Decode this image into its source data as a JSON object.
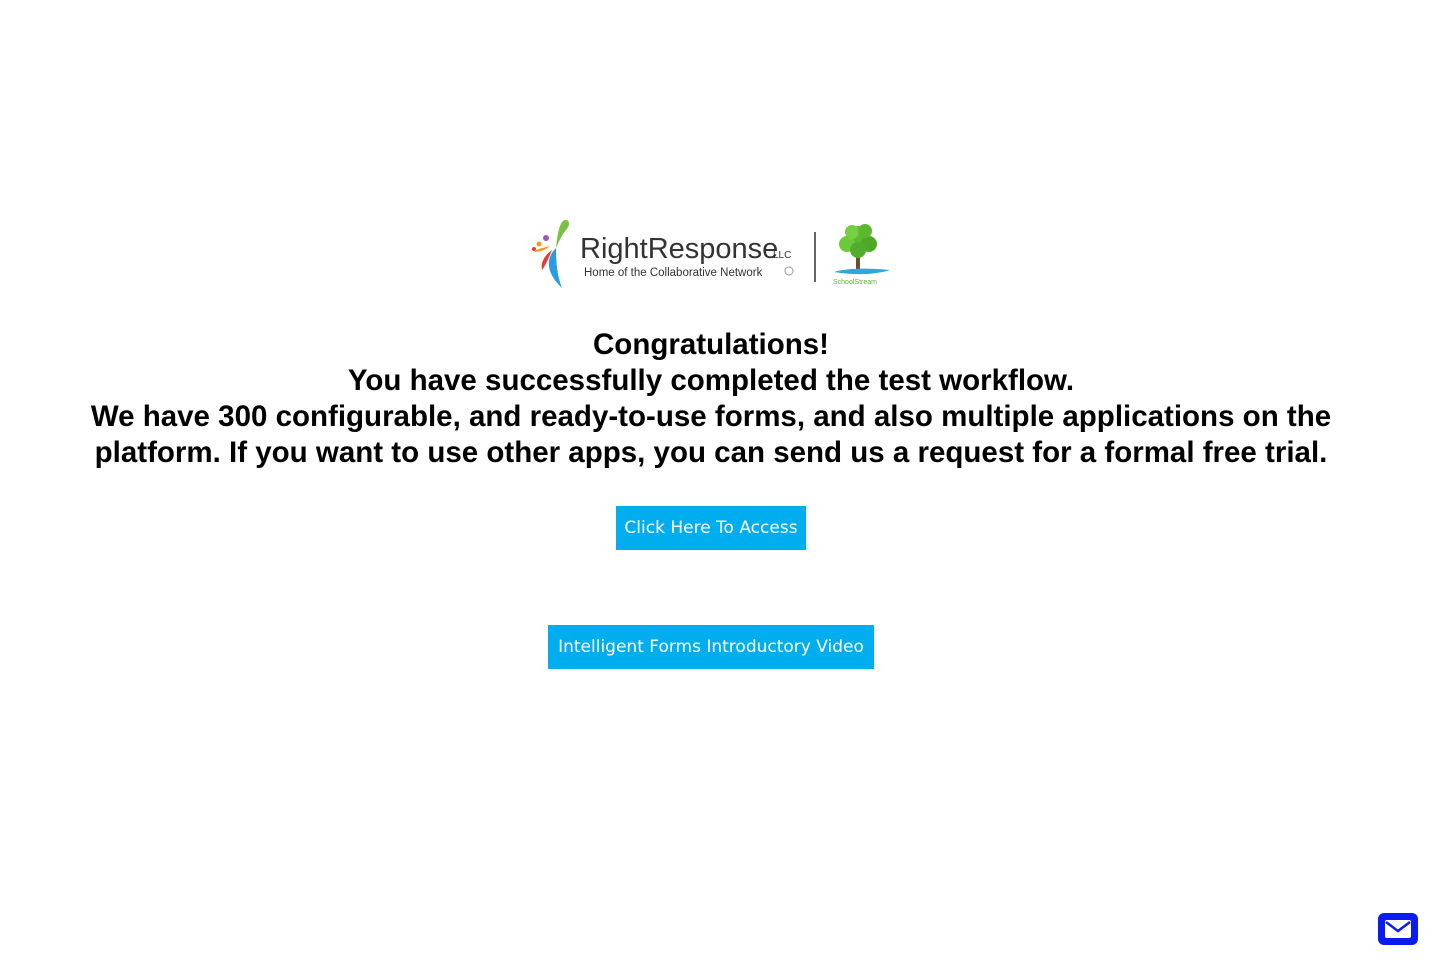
{
  "logo": {
    "brand_name": "RightResponse",
    "brand_suffix": "LLC",
    "tagline": "Home of the Collaborative Network",
    "partner_name": "SchoolStream",
    "colors": {
      "brand_text": "#333333",
      "tree_green": "#5cb82e",
      "stream_blue": "#2aa9e0"
    }
  },
  "message": {
    "line1": "Congratulations!",
    "line2": "You have successfully completed the test workflow.",
    "line3": "We have 300 configurable, and ready-to-use forms, and also multiple applications on the",
    "line4": "platform. If you want to use other apps, you can send us a request for a formal free trial."
  },
  "buttons": {
    "access_label": "Click Here To Access",
    "video_label": "Intelligent Forms Introductory Video"
  },
  "contact": {
    "icon": "mail-icon"
  },
  "colors": {
    "button_bg": "#00aef0",
    "mail_button_bg": "#0a1cf0"
  }
}
